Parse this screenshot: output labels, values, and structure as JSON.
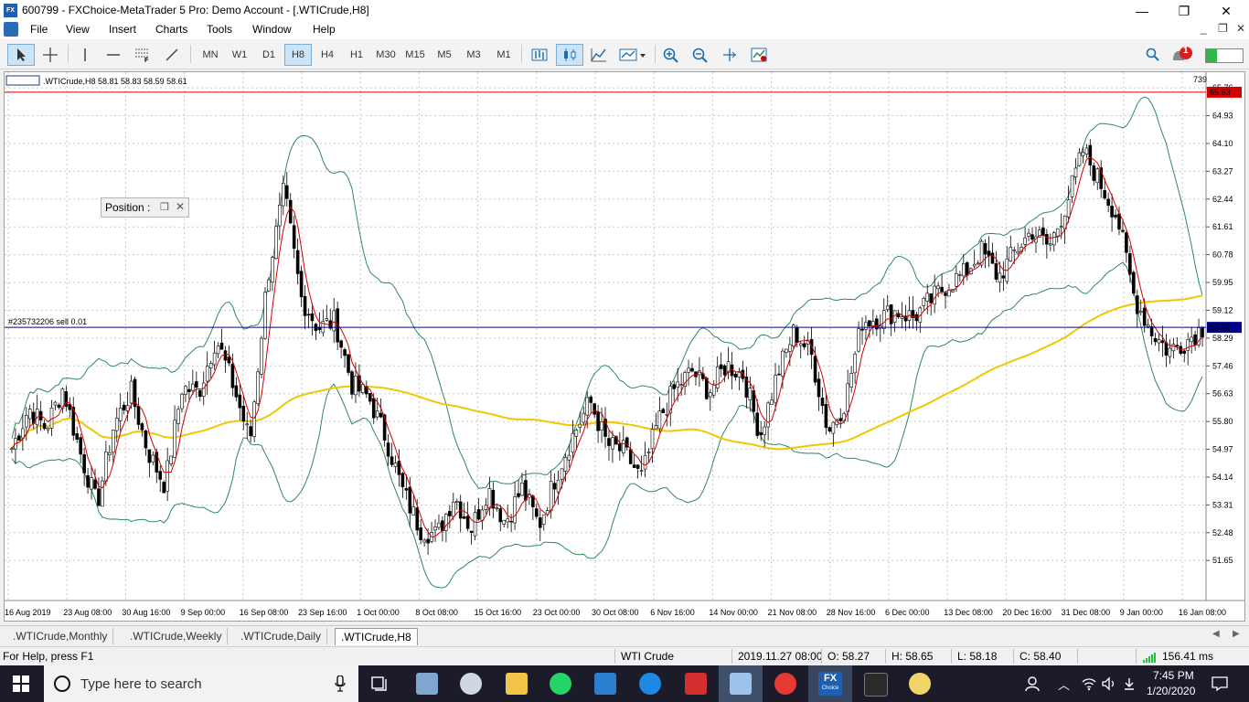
{
  "window": {
    "title": "600799 - FXChoice-MetaTrader 5 Pro: Demo Account - [.WTICrude,H8]",
    "icon_label": "FX",
    "minimize": "—",
    "maximize": "❐",
    "close": "✕"
  },
  "menu": {
    "items": [
      "File",
      "View",
      "Insert",
      "Charts",
      "Tools",
      "Window",
      "Help"
    ],
    "mdi_minimize": "_",
    "mdi_restore": "❐",
    "mdi_close": "✕"
  },
  "toolbar": {
    "timeframes": [
      "MN",
      "W1",
      "D1",
      "H8",
      "H4",
      "H1",
      "M30",
      "M15",
      "M5",
      "M3",
      "M1"
    ],
    "active_timeframe": "H8",
    "notification_count": "1"
  },
  "chart": {
    "header": ".WTICrude,H8  58.81 58.83 58.59 58.61",
    "top_right_value": "739",
    "position_line_label": "#235732206 sell 0.01",
    "position_panel_label": "Position :",
    "price_labels": [
      "65.76",
      "64.93",
      "64.10",
      "63.27",
      "62.44",
      "61.61",
      "60.78",
      "59.95",
      "59.12",
      "58.29",
      "57.46",
      "56.63",
      "55.80",
      "54.97",
      "54.14",
      "53.31",
      "52.48",
      "51.65"
    ],
    "current_price": "58.61",
    "high_price": "65.63",
    "date_labels": [
      "16 Aug 2019",
      "23 Aug 08:00",
      "30 Aug 16:00",
      "9 Sep 00:00",
      "16 Sep 08:00",
      "23 Sep 16:00",
      "1 Oct 00:00",
      "8 Oct 08:00",
      "15 Oct 16:00",
      "23 Oct 00:00",
      "30 Oct 08:00",
      "6 Nov 16:00",
      "14 Nov 00:00",
      "21 Nov 08:00",
      "28 Nov 16:00",
      "6 Dec 00:00",
      "13 Dec 08:00",
      "20 Dec 16:00",
      "31 Dec 08:00",
      "9 Jan 00:00",
      "16 Jan 08:00"
    ],
    "colors": {
      "bull": "#000000",
      "bear": "#000000",
      "ma_fast": "#d40000",
      "ma_slow": "#f0c800",
      "bands": "#2e8b57",
      "position_line": "#00008b",
      "high_line": "#d40000"
    }
  },
  "chart_data": {
    "type": "line",
    "ylim": [
      51.0,
      65.9
    ],
    "price_path": [
      55.0,
      56.2,
      55.6,
      56.8,
      54.9,
      53.3,
      55.7,
      56.7,
      54.9,
      53.9,
      56.8,
      56.7,
      58.3,
      56.9,
      55.2,
      60.0,
      62.7,
      59.5,
      58.6,
      58.8,
      56.9,
      56.5,
      55.3,
      53.7,
      52.6,
      52.4,
      53.6,
      52.6,
      53.8,
      52.8,
      53.8,
      52.7,
      54.2,
      55.4,
      56.4,
      55.1,
      54.9,
      54.1,
      55.8,
      56.8,
      57.3,
      56.7,
      57.5,
      57.2,
      55.4,
      57.2,
      58.5,
      57.8,
      55.5,
      56.4,
      58.8,
      58.9,
      59.1,
      58.9,
      59.4,
      59.9,
      60.2,
      60.9,
      60.1,
      60.9,
      61.5,
      61.0,
      62.3,
      63.9,
      62.9,
      61.9,
      59.5,
      58.5,
      57.9,
      58.2,
      58.6
    ],
    "series": [
      {
        "name": "Bands upper"
      },
      {
        "name": "Bands lower"
      },
      {
        "name": "MA fast"
      },
      {
        "name": "MA slow"
      }
    ]
  },
  "tabs": [
    ".WTICrude,Monthly",
    ".WTICrude,Weekly",
    ".WTICrude,Daily",
    ".WTICrude,H8"
  ],
  "active_tab": ".WTICrude,H8",
  "status": {
    "help": "For Help, press F1",
    "symbol": "WTI Crude",
    "datetime": "2019.11.27 08:00",
    "open": "O: 58.27",
    "high": "H: 58.65",
    "low": "L: 58.18",
    "close": "C: 58.40",
    "ping": "156.41 ms"
  },
  "taskbar": {
    "search_placeholder": "Type here to search",
    "time": "7:45 PM",
    "date": "1/20/2020",
    "fx_icon_label": "FX",
    "fx_icon_sub": "Choice"
  }
}
